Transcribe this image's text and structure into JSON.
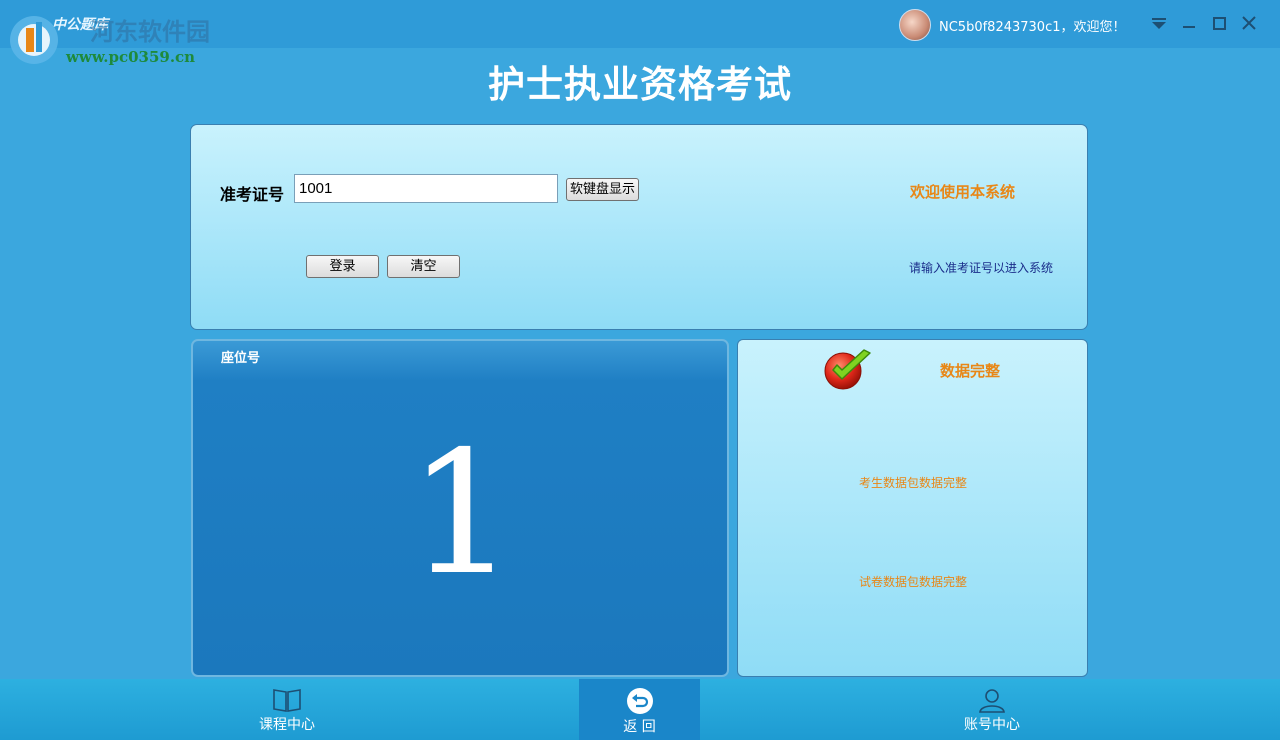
{
  "topbar": {
    "logo_text": "中公题库",
    "watermark": "河东软件园",
    "watermark_url": "www.pc0359.cn",
    "greeting": "NC5b0f8243730c1，欢迎您！"
  },
  "title": "护士执业资格考试",
  "login": {
    "exam_id_label": "准考证号",
    "exam_id_value": "1001",
    "soft_keyboard_button": "软键盘显示",
    "login_button": "登录",
    "clear_button": "清空",
    "welcome": "欢迎使用本系统",
    "hint": "请输入准考证号以进入系统"
  },
  "seat": {
    "label": "座位号",
    "number": "1"
  },
  "status": {
    "title": "数据完整",
    "candidate_data": "考生数据包数据完整",
    "paper_data": "试卷数据包数据完整"
  },
  "nav": {
    "courses": "课程中心",
    "back": "返 回",
    "account": "账号中心"
  },
  "colors": {
    "background": "#3ba7de",
    "accent_orange": "#e88717",
    "seat_blue": "#1b78bd",
    "hint_navy": "#1a2d8a"
  },
  "icons": [
    "app-logo-icon",
    "avatar",
    "menu-dropdown-icon",
    "minimize-icon",
    "maximize-icon",
    "close-icon",
    "checkmark-icon",
    "book-icon",
    "return-icon",
    "user-icon"
  ]
}
